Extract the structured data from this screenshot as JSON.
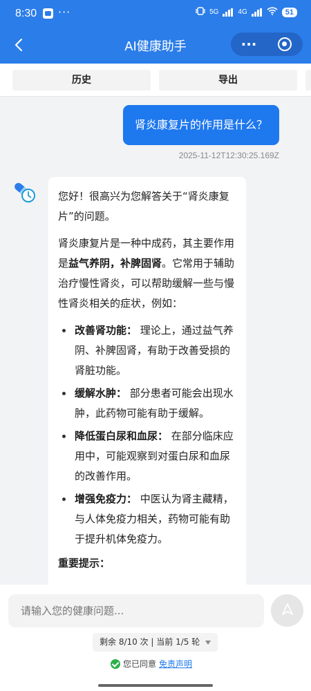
{
  "status_bar": {
    "time": "8:30",
    "dots": "···",
    "network_1": "5G",
    "network_2": "4G",
    "battery": "51"
  },
  "header": {
    "title": "AI健康助手",
    "more_label": "···"
  },
  "toolbar": {
    "history_label": "历史",
    "export_label": "导出"
  },
  "chat": {
    "user_message": "肾炎康复片的作用是什么？",
    "timestamp": "2025-11-12T12:30:25.169Z",
    "bot": {
      "greeting": "您好！很高兴为您解答关于“肾炎康复片”的问题。",
      "intro_pre": "肾炎康复片是一种中成药，其主要作用是",
      "intro_bold": "益气养阴，补脾固肾",
      "intro_post": "。它常用于辅助治疗慢性肾炎，可以帮助缓解一些与慢性肾炎相关的症状，例如：",
      "items": [
        {
          "title": "改善肾功能：",
          "text": "理论上，通过益气养阴、补脾固肾，有助于改善受损的肾脏功能。"
        },
        {
          "title": "缓解水肿：",
          "text": "部分患者可能会出现水肿，此药物可能有助于缓解。"
        },
        {
          "title": "降低蛋白尿和血尿：",
          "text": "在部分临床应用中，可能观察到对蛋白尿和血尿的改善作用。"
        },
        {
          "title": "增强免疫力：",
          "text": "中医认为肾主藏精，与人体免疫力相关，药物可能有助于提升机体免疫力。"
        }
      ],
      "notice_title": "重要提示："
    }
  },
  "input": {
    "placeholder": "请输入您的健康问题..."
  },
  "quota": {
    "text": "剩余 8/10 次 | 当前 1/5 轮"
  },
  "agreement": {
    "text": "您已同意",
    "link": "免责声明"
  },
  "colors": {
    "header_blue": "#2b7de9",
    "user_bubble": "#1e78ee",
    "accent_green": "#2bb14a"
  }
}
